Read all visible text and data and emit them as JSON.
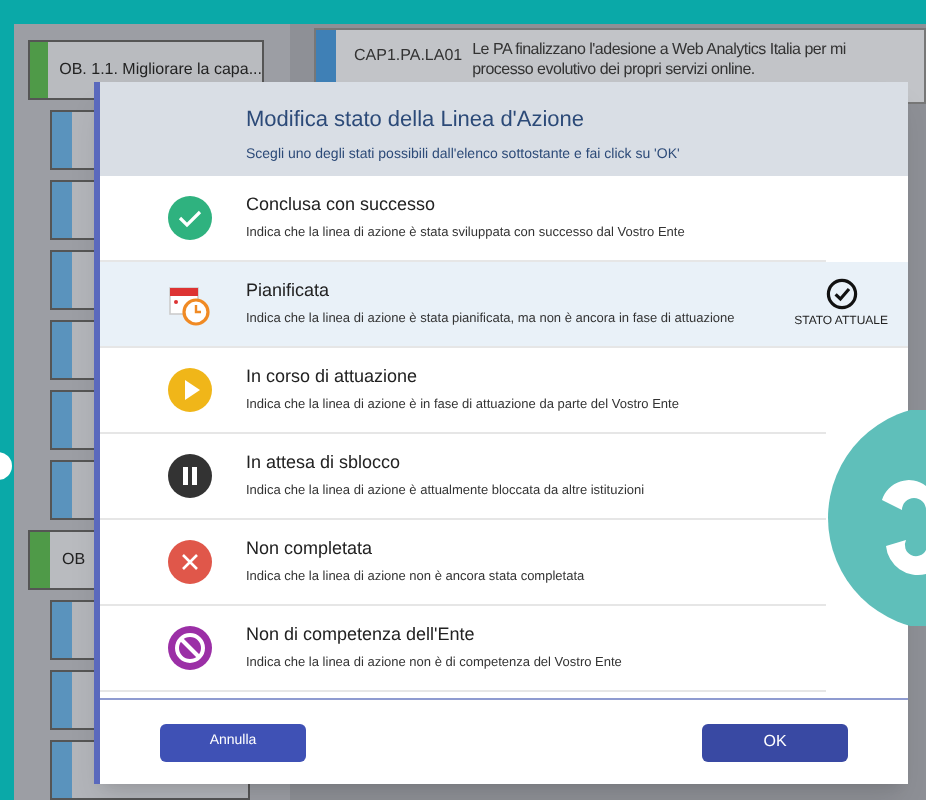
{
  "background": {
    "objective_card": {
      "label": "OB. 1.1. Migliorare la capa..."
    },
    "second_objective_card": {
      "label": "OB"
    },
    "action_card": {
      "code": "CAP1.PA.LA01",
      "text_line_1": "Le PA finalizzano l'adesione a Web Analytics Italia per mi",
      "text_line_2": "processo evolutivo dei propri servizi online."
    }
  },
  "modal": {
    "title": "Modifica stato della Linea d'Azione",
    "subtitle": "Scegli uno degli stati possibili dall'elenco sottostante e fai click su 'OK'",
    "options": [
      {
        "kind": "success",
        "title": "Conclusa con successo",
        "description": "Indica che la linea di azione è stata sviluppata con successo dal Vostro Ente",
        "selected": false
      },
      {
        "kind": "planned",
        "title": "Pianificata",
        "description": "Indica che la linea di azione è stata pianificata, ma non è ancora in fase di attuazione",
        "selected": true
      },
      {
        "kind": "in_progress",
        "title": "In corso di attuazione",
        "description": "Indica che la linea di azione è in fase di attuazione da parte del Vostro Ente",
        "selected": false
      },
      {
        "kind": "blocked",
        "title": "In attesa di sblocco",
        "description": "Indica che la linea di azione è attualmente bloccata da altre istituzioni",
        "selected": false
      },
      {
        "kind": "not_completed",
        "title": "Non completata",
        "description": "Indica che la linea di azione non è ancora stata completata",
        "selected": false
      },
      {
        "kind": "not_competent",
        "title": "Non di competenza dell'Ente",
        "description": "Indica che la linea di azione non è di competenza del Vostro Ente",
        "selected": false
      }
    ],
    "current_label": "STATO ATTUALE",
    "cancel_button": "Annulla",
    "ok_button": "OK"
  }
}
